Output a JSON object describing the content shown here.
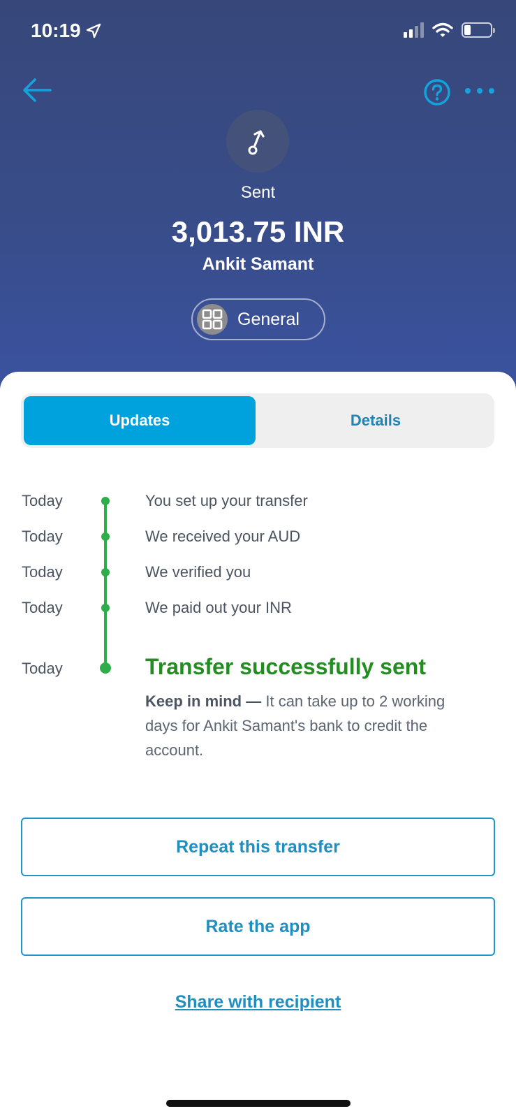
{
  "status_bar": {
    "time": "10:19",
    "battery_level": 0.25
  },
  "header": {
    "back_icon": "arrow-left-icon",
    "help_icon": "question-circle-icon",
    "more_icon": "more-dots-icon",
    "status_label": "Sent",
    "amount": "3,013.75 INR",
    "recipient": "Ankit Samant",
    "category": "General"
  },
  "tabs": [
    {
      "label": "Updates",
      "active": true
    },
    {
      "label": "Details",
      "active": false
    }
  ],
  "timeline": [
    {
      "date": "Today",
      "text": "You set up your transfer"
    },
    {
      "date": "Today",
      "text": "We received your AUD"
    },
    {
      "date": "Today",
      "text": "We verified you"
    },
    {
      "date": "Today",
      "text": "We paid out your INR"
    }
  ],
  "final_step": {
    "date": "Today",
    "title": "Transfer successfully sent",
    "note_bold": "Keep in mind —",
    "note_text": " It can take up to 2 working days for Ankit Samant's bank to credit the account."
  },
  "actions": {
    "repeat": "Repeat this transfer",
    "rate": "Rate the app",
    "share": "Share with recipient"
  },
  "colors": {
    "header_bg": "#384d8a",
    "accent_blue": "#00a2dd",
    "link_blue": "#1f8fc1",
    "success_green": "#248d22",
    "timeline_green": "#2ead4b"
  }
}
